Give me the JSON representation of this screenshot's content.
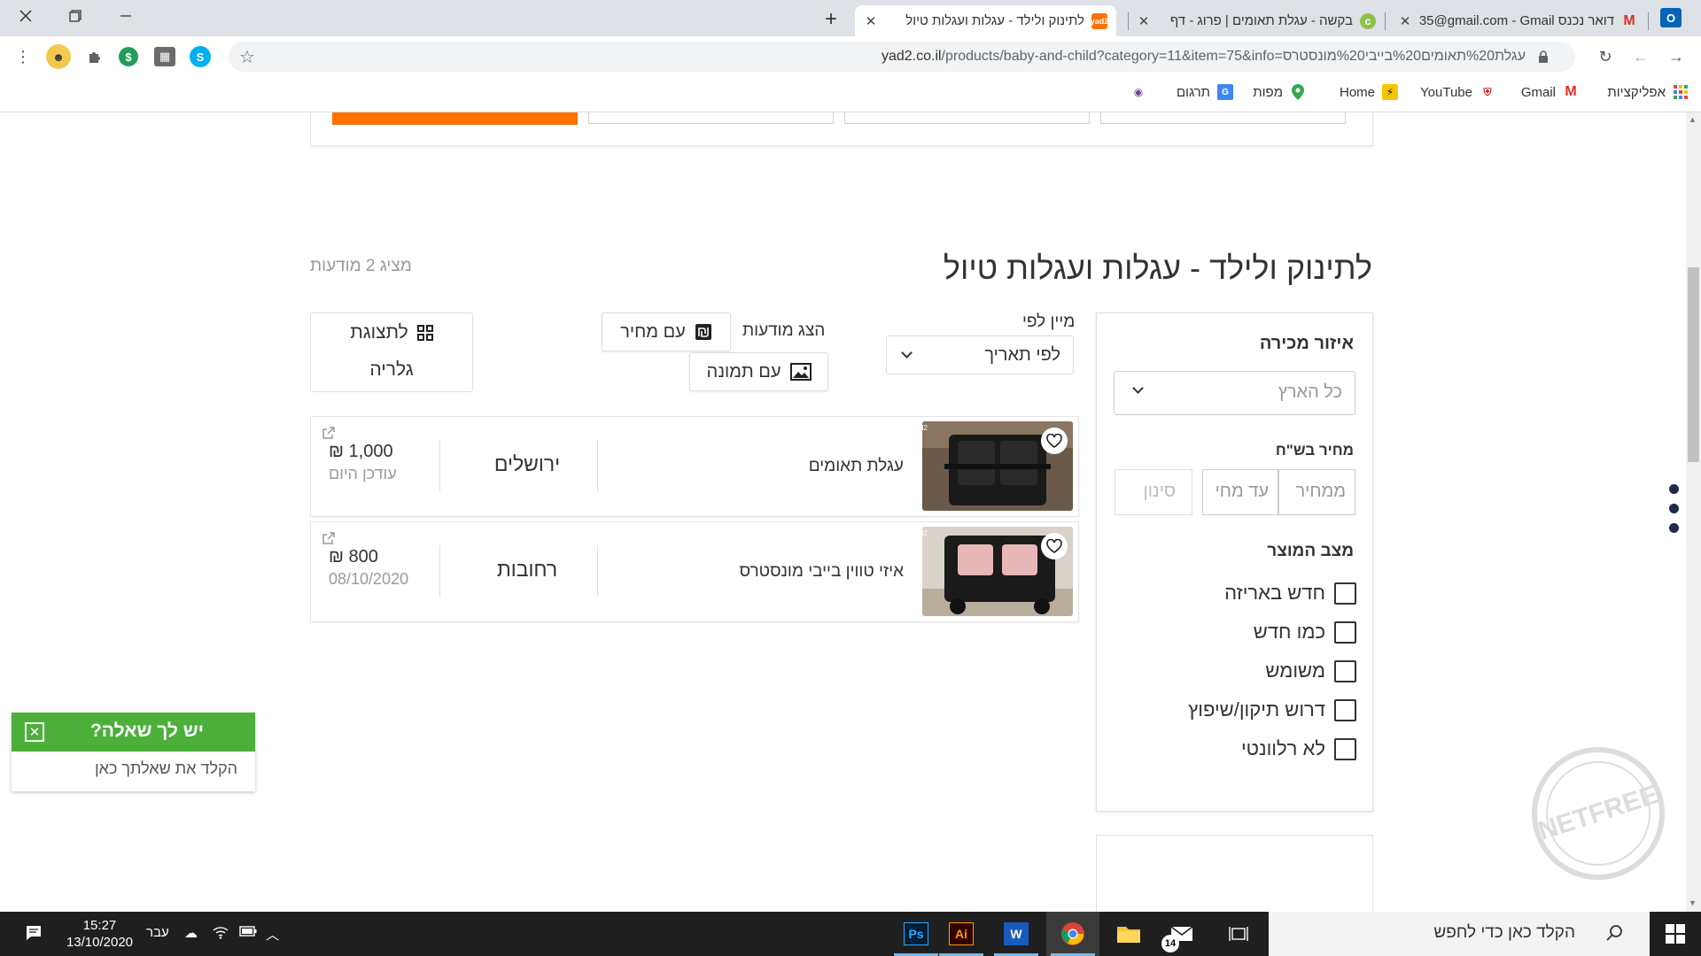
{
  "browser": {
    "tabs": [
      {
        "title": "לתינוק ולילד - עגלות ועגלות טיול",
        "favicon": "yad2-icon",
        "active": true
      },
      {
        "title": "בקשה - עגלת תאומים | פרוג - דף",
        "favicon": "prog-icon",
        "active": false
      },
      {
        "title": "דואר נכנס Gmail - ‏‎35@gmail.com",
        "favicon": "gmail-icon",
        "active": false
      }
    ],
    "url": {
      "host": "yad2.co.il",
      "path": "/products/baby-and-child?category=11&item=75&info=עגלת%20תאומים%20בייבי%20מונסטרס"
    },
    "bookmarks": [
      "אפליקציות",
      "Gmail",
      "YouTube",
      "Home",
      "מפות",
      "תרגום"
    ]
  },
  "page": {
    "title": "לתינוק ולילד - עגלות ועגלות טיול",
    "ads_count": "מציג 2 מודעות",
    "sort": {
      "label": "מיין לפי",
      "value": "לפי תאריך"
    },
    "display": {
      "label": "הצג מודעות",
      "with_price": "עם מחיר",
      "with_image": "עם תמונה"
    },
    "gallery": {
      "line1": "לתצוגת",
      "line2": "גלריה"
    }
  },
  "filters": {
    "area_label": "איזור מכירה",
    "area_placeholder": "כל הארץ",
    "price_label": "מחיר בש\"ח",
    "price_from": "ממחיר",
    "price_to": "עד מחי",
    "price_filter": "סינון",
    "condition_label": "מצב המוצר",
    "conditions": [
      "חדש באריזה",
      "כמו חדש",
      "משומש",
      "דרוש תיקון/שיפוץ",
      "לא רלוונטי"
    ]
  },
  "listings": [
    {
      "title": "עגלת תאומים",
      "city": "ירושלים",
      "price": "1,000 ₪",
      "date": "עודכן היום"
    },
    {
      "title": "איזי טווין בייבי מונסטרס",
      "city": "רחובות",
      "price": "800 ₪",
      "date": "08/10/2020"
    }
  ],
  "chat": {
    "title": "יש לך שאלה?",
    "placeholder": "הקלד את שאלתך כאן"
  },
  "watermark": "NETFREE מחשב מוגן",
  "taskbar": {
    "search_placeholder": "הקלד כאן כדי לחפש",
    "time": "15:27",
    "date": "13/10/2020",
    "lang": "עבר",
    "mail_badge": "14"
  },
  "colors": {
    "accent": "#ff7100",
    "chat_green": "#4caf3a",
    "dots": "#1d2a4a"
  }
}
